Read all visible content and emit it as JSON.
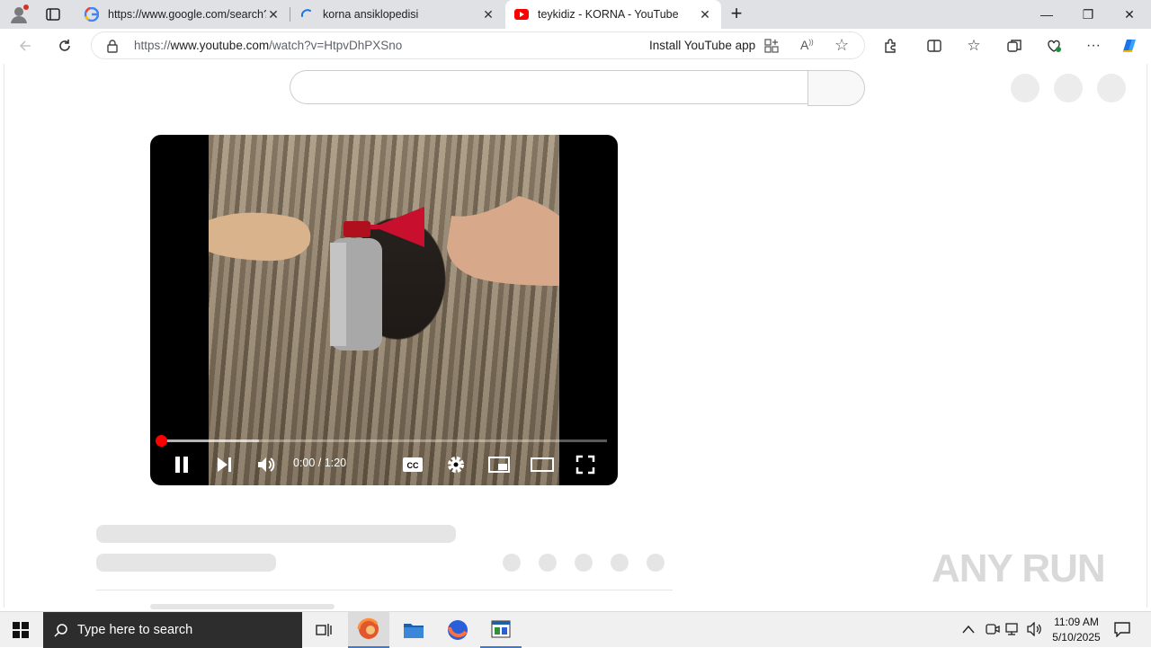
{
  "browser": {
    "tabs": [
      {
        "title": "https://www.google.com/search?q",
        "icon": "google-icon",
        "active": false
      },
      {
        "title": "korna ansiklopedisi",
        "icon": "loading-icon",
        "active": false
      },
      {
        "title": "teykidiz - KORNA - YouTube",
        "icon": "youtube-icon",
        "active": true
      }
    ],
    "new_tab_label": "+",
    "address": {
      "prefix": "https://",
      "domain": "www.youtube.com",
      "path": "/watch?v=HtpvDhPXSno"
    },
    "install_label": "Install YouTube app"
  },
  "player": {
    "time_current": "0:00",
    "time_separator": " / ",
    "time_total": "1:20",
    "progress_fraction": 0.0,
    "buffered_fraction": 0.22
  },
  "watermark": "ANY RUN",
  "taskbar": {
    "search_placeholder": "Type here to search",
    "time": "11:09 AM",
    "date": "5/10/2025"
  },
  "colors": {
    "accent_red": "#ff0000",
    "taskbar_search_bg": "#2d2d2d",
    "skeleton": "#e5e5e5"
  }
}
